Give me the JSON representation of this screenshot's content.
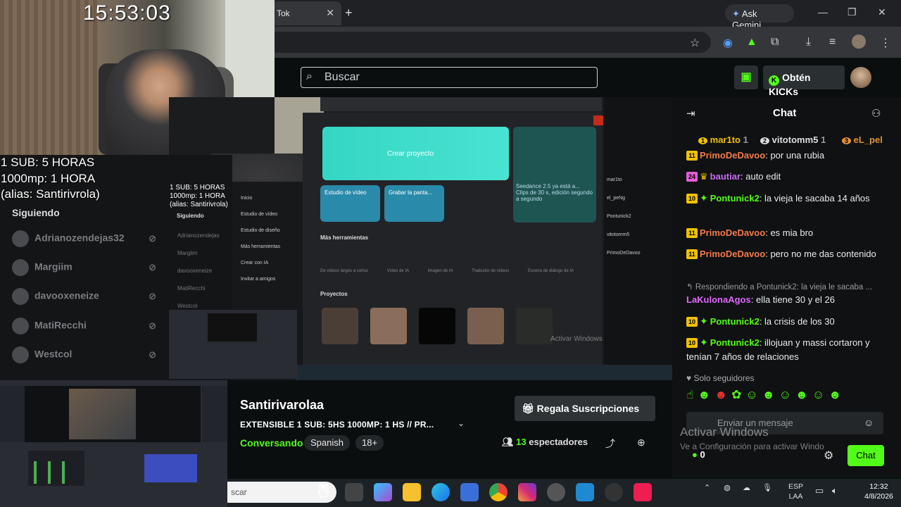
{
  "browser": {
    "tab_title": "Tok",
    "tab_close": "✕",
    "new_tab": "+",
    "gemini_label": "Ask Gemini",
    "window_controls": [
      "—",
      "❐",
      "✕"
    ]
  },
  "kick_header": {
    "search_placeholder": "Buscar",
    "kicks_label": "Obtén KICKs"
  },
  "overlay": {
    "clock": "15:53:03",
    "line1": "1 SUB: 5 HORAS",
    "line2": "1000mp: 1 HORA",
    "line3": "(alias: Santirivrola)"
  },
  "left_sidebar": {
    "section_title": "Siguiendo",
    "items": [
      {
        "name": "Adrianozendejas32"
      },
      {
        "name": "Margiim"
      },
      {
        "name": "davooxeneize"
      },
      {
        "name": "MatiRecchi"
      },
      {
        "name": "Westcol"
      }
    ]
  },
  "nested": {
    "create_label": "Crear proyecto",
    "seedance_text": "Seedance 2.5 ya está a... Clips de 30 s, edición segundo a segundo",
    "tile1": "Estudio de vídeo",
    "tile2": "Grabar la panta...",
    "more_tools": "Más herramientas",
    "projects": "Proyectos",
    "nav": [
      "Inicio",
      "Estudio de vídeo",
      "Estudio de diseño",
      "Más herramientas",
      "Crear con IA",
      "Invitar a amigos"
    ],
    "tools": [
      "De vídeos largos a cortos",
      "Vídeo de IA",
      "Imagen de IA",
      "Traductor de vídeos",
      "Escena de diálogo de IA"
    ],
    "watermark": "Activar Windows",
    "overlay_mini1": "1 SUB: 5 HORAS",
    "overlay_mini2": "1000mp: 1 HORA",
    "overlay_mini3": "(alias: Santirivrola)",
    "siguiendo": "Siguiendo",
    "mini_follow": [
      "Adrianozendejas",
      "Margiim",
      "davooxeneize",
      "MatiRecchi",
      "Westcol"
    ],
    "mini_chat": [
      "mar1to",
      "el_peNg",
      "Pontunick2",
      "vitotomm5",
      "PrimoDeDavoo"
    ]
  },
  "channel": {
    "streamer": "Santirivarolaa",
    "title": "EXTENSIBLE  1 SUB: 5HS  1000MP: 1 HS // PR...",
    "category": "Conversando",
    "tags": [
      "Spanish",
      "18+"
    ],
    "gift_label": "Regala Suscripciones",
    "viewers_count": "13",
    "viewers_label": "espectadores"
  },
  "chat": {
    "title": "Chat",
    "leaders": [
      {
        "rank": "1",
        "name": "mar1to",
        "count": "1"
      },
      {
        "rank": "2",
        "name": "vitotomm5",
        "count": "1"
      },
      {
        "rank": "3",
        "name": "eL_pel",
        "count": ""
      }
    ],
    "messages": [
      {
        "badge": "11",
        "user": "PrimoDeDavoo",
        "text": "por una rubia",
        "color": "red"
      },
      {
        "badge": "24",
        "user": "bautiar",
        "text": "auto edit",
        "color": "purple"
      },
      {
        "badge": "10",
        "user": "Pontunick2",
        "text": "la vieja le sacaba 14 años",
        "color": "green"
      },
      {
        "badge": "11",
        "user": "PrimoDeDavoo",
        "text": "es mia bro",
        "color": "red"
      },
      {
        "badge": "11",
        "user": "PrimoDeDavoo",
        "text": "pero no me das contenido",
        "color": "red"
      },
      {
        "reply": "Respondiendo a Pontunick2: la vieja le sacaba ...",
        "user": "LaKulonaAgos",
        "text": "ella tiene 30 y el 26",
        "color": "pink"
      },
      {
        "badge": "10",
        "user": "Pontunick2",
        "text": "la crisis de los 30",
        "color": "green"
      },
      {
        "badge": "10",
        "user": "Pontunick2",
        "text": "illojuan y massi cortaron y tenían 7 años de relaciones",
        "color": "green"
      }
    ],
    "followers_only": "Solo seguidores",
    "input_placeholder": "Enviar un mensaje",
    "send_label": "Chat",
    "points": "0",
    "watermark1": "Activar Windows",
    "watermark2": "Ve a Configuración para activar Windo"
  },
  "taskbar": {
    "search_text": "scar",
    "lang1": "ESP",
    "lang2": "LAA",
    "time": "12:32",
    "date": "4/8/2026"
  }
}
